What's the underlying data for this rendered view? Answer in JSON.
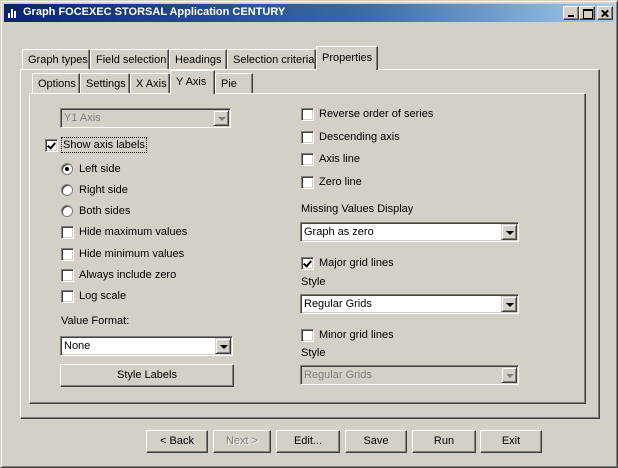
{
  "window": {
    "title": "Graph FOCEXEC STORSAL Application CENTURY",
    "icon": "bar-chart-icon"
  },
  "main_tabs": [
    "Graph types",
    "Field selection",
    "Headings",
    "Selection criteria",
    "Properties"
  ],
  "main_tab_active": "Properties",
  "sub_tabs": [
    "Options",
    "Settings",
    "X Axis",
    "Y Axis",
    "Pie"
  ],
  "sub_tab_active": "Y Axis",
  "left": {
    "axis_select": "Y1 Axis",
    "show_axis_labels": {
      "label": "Show axis labels",
      "checked": true
    },
    "position_radios": [
      {
        "label": "Left side",
        "selected": true
      },
      {
        "label": "Right side",
        "selected": false
      },
      {
        "label": "Both sides",
        "selected": false
      }
    ],
    "options": [
      {
        "label": "Hide maximum values",
        "checked": false
      },
      {
        "label": "Hide minimum values",
        "checked": false
      },
      {
        "label": "Always include zero",
        "checked": false
      },
      {
        "label": "Log scale",
        "checked": false
      }
    ],
    "value_format_label": "Value Format:",
    "value_format": "None",
    "style_labels_button": "Style Labels"
  },
  "right": {
    "options": [
      {
        "label": "Reverse order of series",
        "checked": false
      },
      {
        "label": "Descending axis",
        "checked": false
      },
      {
        "label": "Axis line",
        "checked": false
      },
      {
        "label": "Zero line",
        "checked": false
      }
    ],
    "missing_values_label": "Missing Values Display",
    "missing_values": "Graph as zero",
    "major_grid": {
      "label": "Major grid lines",
      "checked": true
    },
    "major_style_label": "Style",
    "major_style": "Regular Grids",
    "minor_grid": {
      "label": "Minor grid lines",
      "checked": false
    },
    "minor_style_label": "Style",
    "minor_style": "Regular Grids"
  },
  "footer": {
    "back": "< Back",
    "next": "Next >",
    "edit": "Edit...",
    "save": "Save",
    "run": "Run",
    "exit": "Exit"
  }
}
